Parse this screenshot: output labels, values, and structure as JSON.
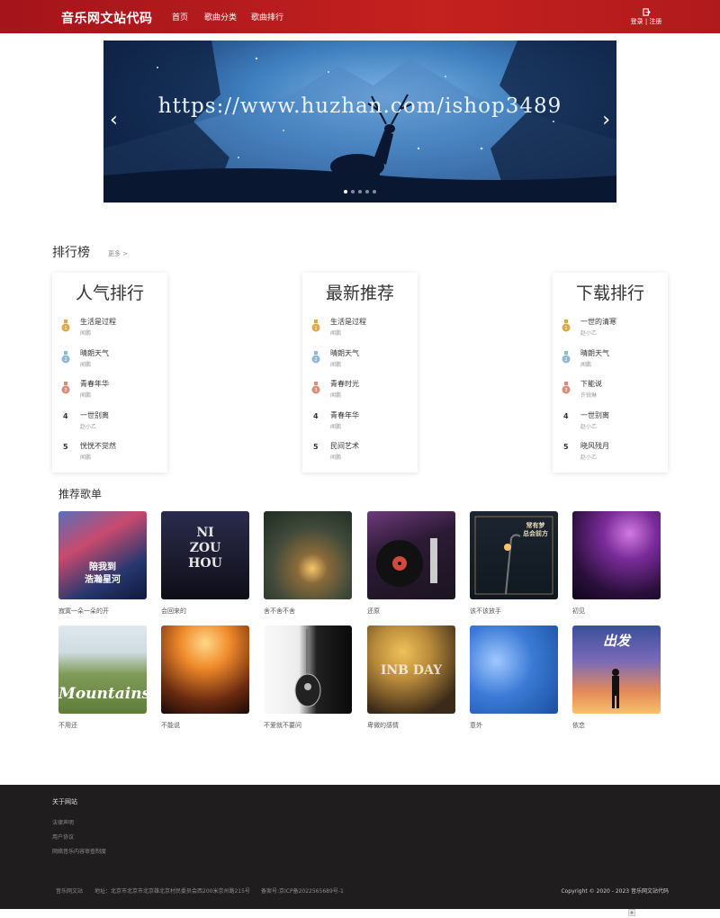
{
  "header": {
    "brand": "音乐网文站代码",
    "nav": [
      "首页",
      "歌曲分类",
      "歌曲排行"
    ],
    "login": "登录",
    "register": "注册"
  },
  "banner": {
    "url_text": "https://www.huzhan.com/ishop3489",
    "prev": "‹",
    "next": "›",
    "slide_count": 5,
    "active_slide": 1
  },
  "ranking": {
    "title": "排行榜",
    "more": "更多 >",
    "boards": [
      {
        "title": "人气排行",
        "items": [
          {
            "rank": "1",
            "name": "生活是过程",
            "artist": "闻鹏"
          },
          {
            "rank": "2",
            "name": "晴朗天气",
            "artist": "闻鹏"
          },
          {
            "rank": "3",
            "name": "青春年华",
            "artist": "闻鹏"
          },
          {
            "rank": "4",
            "name": "一世别离",
            "artist": "赵小乙"
          },
          {
            "rank": "5",
            "name": "恍恍不觉然",
            "artist": "闻鹏"
          }
        ]
      },
      {
        "title": "最新推荐",
        "items": [
          {
            "rank": "1",
            "name": "生活是过程",
            "artist": "闻鹏"
          },
          {
            "rank": "2",
            "name": "晴朗天气",
            "artist": "闻鹏"
          },
          {
            "rank": "3",
            "name": "青春时光",
            "artist": "闻鹏"
          },
          {
            "rank": "4",
            "name": "青春年华",
            "artist": "闻鹏"
          },
          {
            "rank": "5",
            "name": "民间艺术",
            "artist": "闻鹏"
          }
        ]
      },
      {
        "title": "下载排行",
        "items": [
          {
            "rank": "1",
            "name": "一世的清寒",
            "artist": "赵小乙"
          },
          {
            "rank": "2",
            "name": "晴朗天气",
            "artist": "闻鹏"
          },
          {
            "rank": "3",
            "name": "下能说",
            "artist": "许锐琳"
          },
          {
            "rank": "4",
            "name": "一世别离",
            "artist": "赵小乙"
          },
          {
            "rank": "5",
            "name": "晓风残月",
            "artist": "赵小乙"
          }
        ]
      }
    ]
  },
  "playlists": {
    "title": "推荐歌单",
    "items": [
      {
        "label": "寂寞一朵一朵的开",
        "cover_text": "陪我到\n浩瀚星河"
      },
      {
        "label": "会回来的",
        "cover_text": "NI\nZOU\nHOU"
      },
      {
        "label": "舍不舍不舍",
        "cover_text": ""
      },
      {
        "label": "还原",
        "cover_text": ""
      },
      {
        "label": "该不该放手",
        "cover_text": "常有梦\n总会前方"
      },
      {
        "label": "初见",
        "cover_text": ""
      },
      {
        "label": "不用还",
        "cover_text": "Mountains"
      },
      {
        "label": "不能说",
        "cover_text": ""
      },
      {
        "label": "不爱就不要问",
        "cover_text": ""
      },
      {
        "label": "卑微的感情",
        "cover_text": "INB DAY"
      },
      {
        "label": "意外",
        "cover_text": ""
      },
      {
        "label": "依恋",
        "cover_text": "出发"
      }
    ]
  },
  "footer": {
    "heading": "关于网站",
    "links": [
      "法律声明",
      "用户协议",
      "网络音乐内容审查制度"
    ],
    "site_name": "音乐网文站",
    "address": "地址：北京市北京市北京雄北京村民委员会西200米京州路215号",
    "icp": "备案号:京ICP备2022565689号-1",
    "copyright": "Copyright © 2020 - 2023 音乐网文站代码"
  },
  "colors": {
    "header": "#b81c1f",
    "footer": "#1f1d1d",
    "gold": "#d9a94b",
    "silver": "#8fb8d2",
    "bronze": "#d58e78"
  }
}
